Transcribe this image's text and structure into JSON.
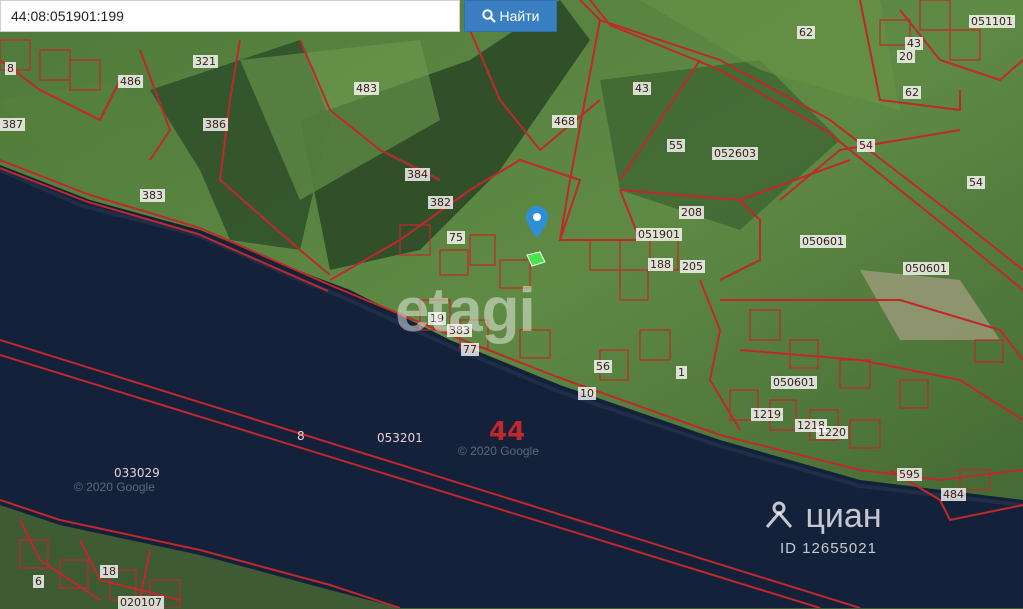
{
  "search": {
    "value": "44:08:051901:199",
    "button_label": "Найти",
    "icon": "search-icon"
  },
  "map": {
    "parcel_labels": [
      "8",
      "321",
      "486",
      "387",
      "483",
      "386",
      "383",
      "384",
      "382",
      "75",
      "19",
      "383",
      "77",
      "468",
      "43",
      "55",
      "052603",
      "54",
      "208",
      "051901",
      "188",
      "205",
      "050601",
      "050601",
      "1",
      "56",
      "10",
      "050601",
      "1219",
      "1218",
      "1220",
      "595",
      "484",
      "62",
      "43",
      "20",
      "62",
      "051101",
      "54",
      "6",
      "18",
      "020107"
    ],
    "water_labels": [
      "8",
      "053201",
      "033029"
    ],
    "district_label": "44",
    "accent": "#c0282c",
    "highlight": "#49e64b"
  },
  "watermarks": {
    "etagi": "etagi",
    "google_1": "© 2020 Google",
    "google_2": "© 2020 Google",
    "cian": "циан",
    "cian_id": "ID 12655021"
  }
}
